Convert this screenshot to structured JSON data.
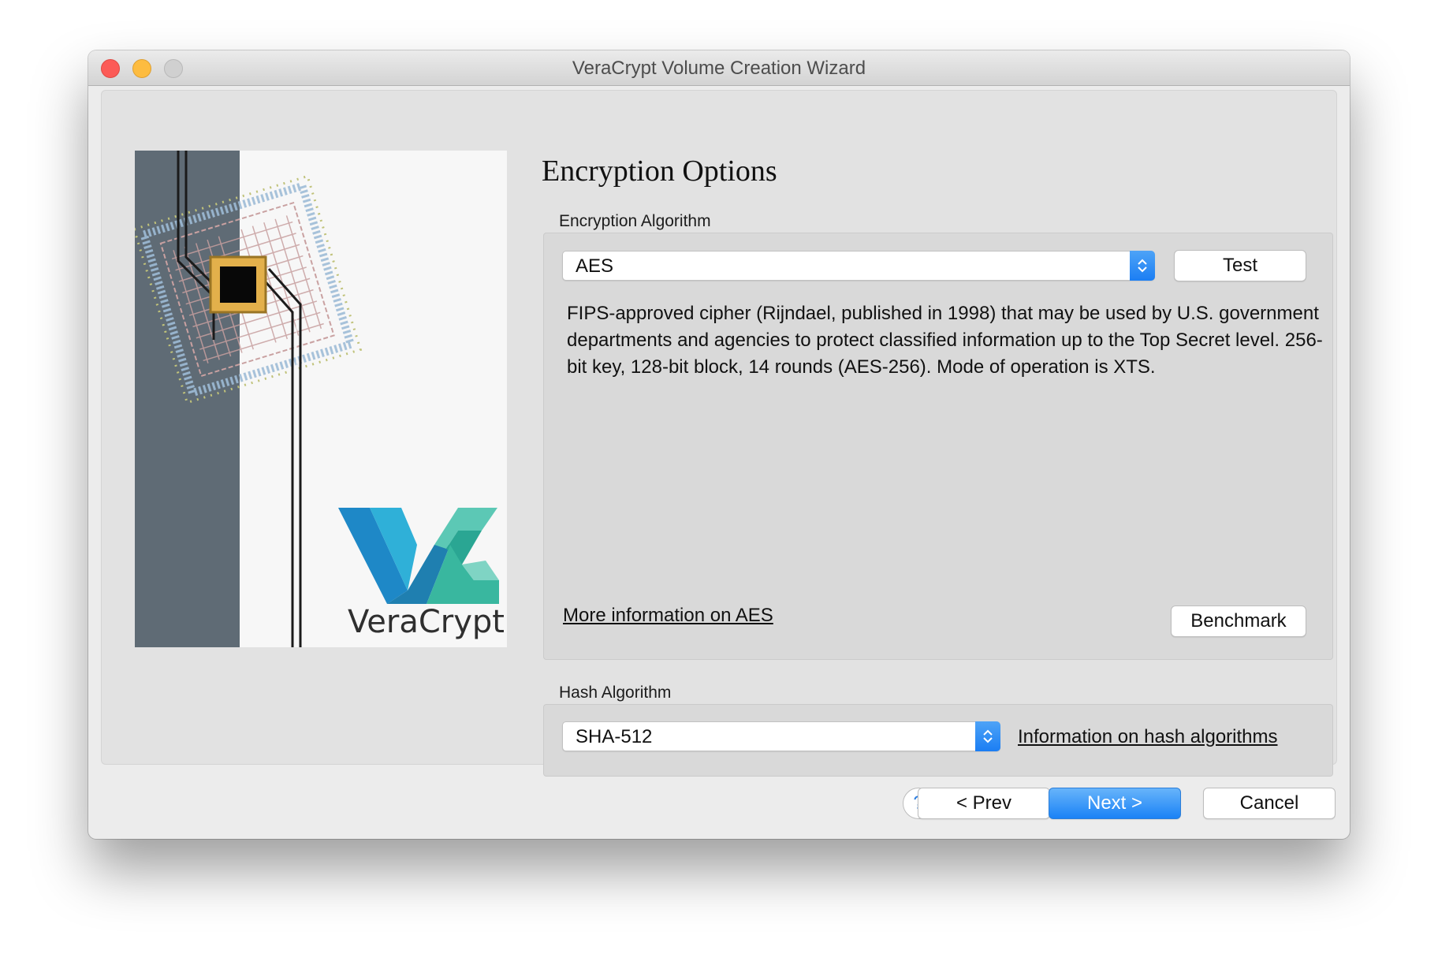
{
  "window": {
    "title": "VeraCrypt Volume Creation Wizard"
  },
  "page": {
    "title": "Encryption Options"
  },
  "encryption": {
    "label": "Encryption Algorithm",
    "selected": "AES",
    "test_button": "Test",
    "description": "FIPS-approved cipher (Rijndael, published in 1998) that may be used by U.S. government departments and agencies to protect classified information up to the Top Secret level. 256-bit key, 128-bit block, 14 rounds (AES-256). Mode of operation is XTS.",
    "more_info_link": "More information on AES",
    "benchmark_button": "Benchmark"
  },
  "hash": {
    "label": "Hash Algorithm",
    "selected": "SHA-512",
    "info_link": "Information on hash algorithms"
  },
  "logo": {
    "text": "VeraCrypt"
  },
  "footer": {
    "help_label": "?",
    "prev_button": "< Prev",
    "next_button": "Next >",
    "cancel_button": "Cancel"
  },
  "colors": {
    "accent": "#1a82f6",
    "logo_teal": "#2bb5a3",
    "logo_blue": "#1e88c7",
    "sidebar_strip": "#5f6b75",
    "chip_gold": "#e3b04b"
  }
}
